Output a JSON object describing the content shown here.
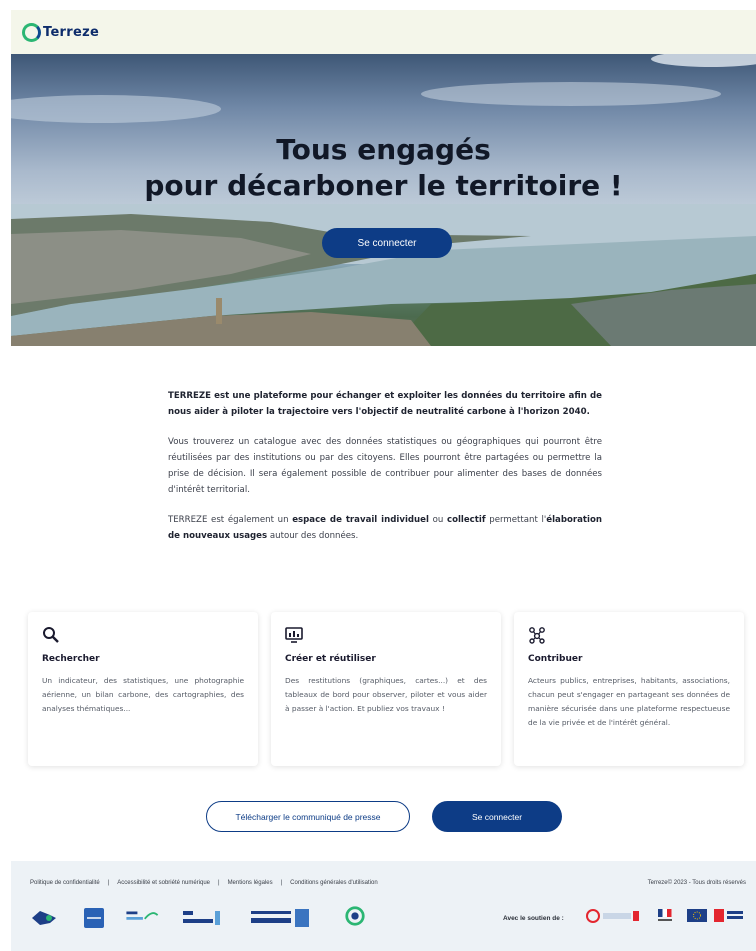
{
  "header": {
    "brand": "Terreze"
  },
  "hero": {
    "title_line1": "Tous engagés",
    "title_line2": "pour décarboner le territoire !",
    "cta_label": "Se connecter"
  },
  "intro": {
    "lead": "TERREZE est une plateforme pour échanger et exploiter les données du territoire afin de nous aider à piloter la trajectoire vers l'objectif de neutralité carbone à l'horizon 2040.",
    "paragraph2": "Vous trouverez un catalogue avec des données statistiques ou géographiques qui pourront être réutilisées par des institutions ou par des citoyens. Elles pourront être partagées ou permettre la prise de décision. Il sera également possible de contribuer pour alimenter des bases de données d'intérêt territorial.",
    "p3_part1": "TERREZE est également un ",
    "p3_bold1": "espace de travail individuel",
    "p3_part2": " ou ",
    "p3_bold2": "collectif",
    "p3_part3": " permettant l'",
    "p3_bold3": "élaboration de nouveaux usages",
    "p3_part4": " autour des données."
  },
  "cards": [
    {
      "icon": "search-icon",
      "title": "Rechercher",
      "text": "Un indicateur, des statistiques, une photographie aérienne, un bilan carbone, des cartographies, des analyses thématiques..."
    },
    {
      "icon": "dashboard-icon",
      "title": "Créer et réutiliser",
      "text": "Des restitutions (graphiques, cartes...) et des tableaux de bord pour observer, piloter et vous aider à passer à l'action. Et publiez vos travaux !"
    },
    {
      "icon": "network-icon",
      "title": "Contribuer",
      "text": "Acteurs publics, entreprises, habitants, associations, chacun peut s'engager en partageant ses données de manière sécurisée dans une plateforme respectueuse de la vie privée et de l'intérêt général."
    }
  ],
  "actions": {
    "press_label": "Télécharger le communiqué de presse",
    "login_label": "Se connecter"
  },
  "footer": {
    "links": [
      "Politique de confidentialité",
      "Accessibilité et sobriété numérique",
      "Mentions légales",
      "Conditions générales d'utilisation"
    ],
    "copyright": "Terreze© 2023 - Tous droits réservés",
    "support_label": "Avec le soutien de :"
  },
  "colors": {
    "primary": "#0d3c86",
    "header_bg": "#f4f6ea",
    "footer_bg": "#edf2f6",
    "brand_green": "#2bb673"
  }
}
